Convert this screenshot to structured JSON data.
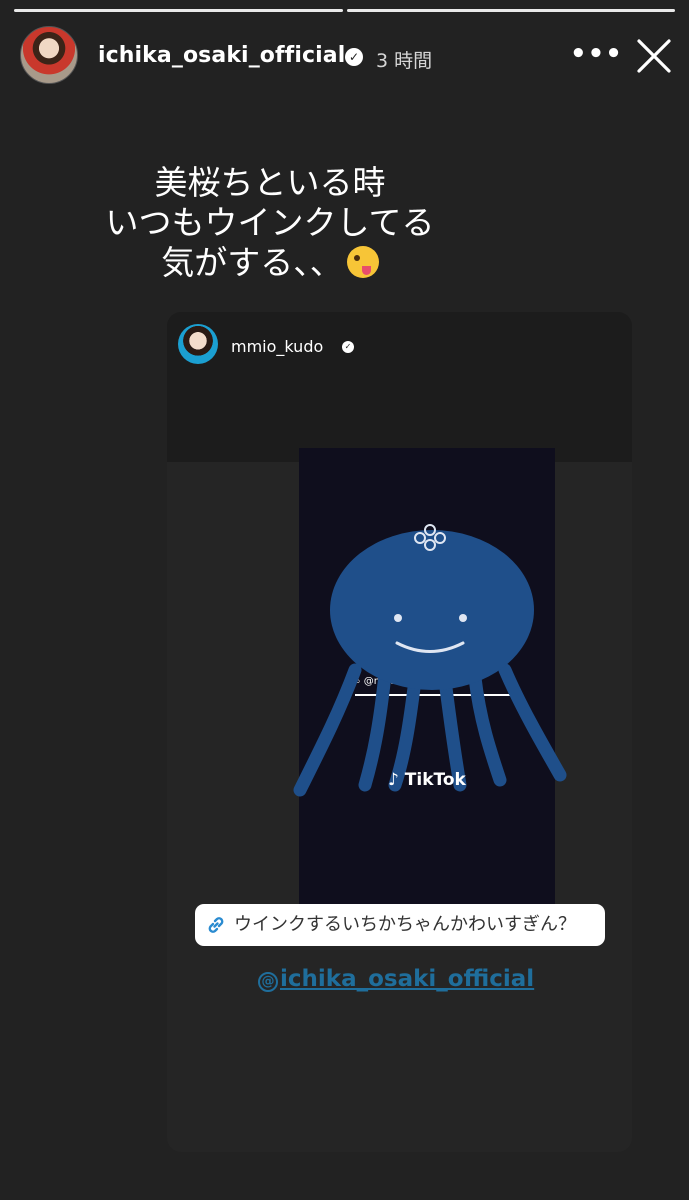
{
  "story": {
    "progress_segments": [
      1.0,
      1.0
    ],
    "author": {
      "username": "ichika_osaki_official",
      "verified": true
    },
    "time": "3 時間",
    "more_label": "•••",
    "caption_lines": [
      "美桜ちといる時",
      "いつもウインクしてる",
      "気がする、、"
    ],
    "caption_emoji": "zany-face-emoji"
  },
  "shared_post": {
    "username": "mmio_kudo",
    "verified": true,
    "video_overlay": {
      "search_text": "@mm",
      "watermark": "TikTok"
    }
  },
  "link_sticker": {
    "text": "ウインクするいちかちゃんかわいすぎん？",
    "icon": "link-icon"
  },
  "mention_sticker": {
    "username": "ichika_osaki_official",
    "symbol": "@"
  },
  "colors": {
    "background": "#222222",
    "accent_mention": "#1f6e9c",
    "jellyfish": "#1f4f8a"
  }
}
